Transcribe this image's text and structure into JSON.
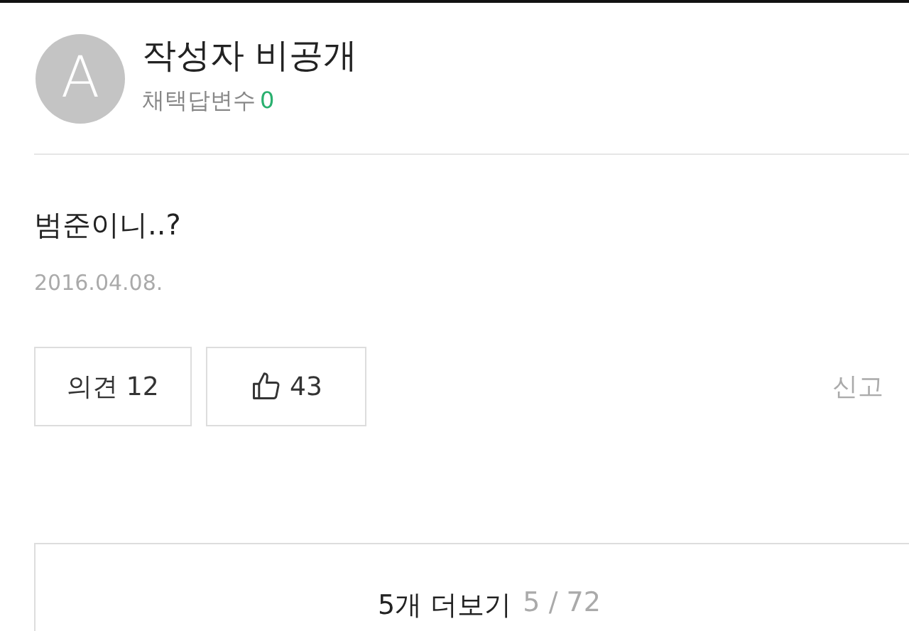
{
  "author": {
    "avatar_letter": "A",
    "name": "작성자 비공개",
    "adopted_label": "채택답변수",
    "adopted_count": "0"
  },
  "answer": {
    "text": "범준이니..?",
    "date": "2016.04.08."
  },
  "actions": {
    "comments_label": "의견",
    "comments_count": "12",
    "likes_count": "43",
    "report": "신고"
  },
  "more": {
    "label": "5개 더보기",
    "shown": "5",
    "separator": "/",
    "total": "72"
  }
}
